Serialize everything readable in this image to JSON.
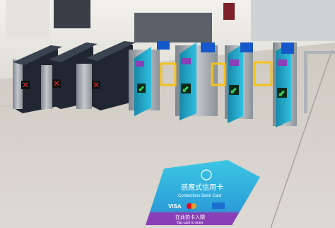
{
  "scene": {
    "description_kind": "photo",
    "colors": {
      "wall": "#e9e7e1",
      "floor": "#d6d2cb",
      "gate_dark": "#1e2530",
      "gate_steel": "#9aa0a6",
      "gate_cyan": "#27b6d9",
      "gate_cyan_dark": "#1888a8",
      "panel_yellow": "#f3c21b",
      "signal_red": "#e1262b",
      "signal_green": "#39d257",
      "screen_blue": "#1558c9",
      "decal_cyan": "#2fc0e0",
      "decal_purple": "#8a3fb6",
      "decal_blue": "#1a6fd1"
    },
    "gate_signals": [
      "stop-icon",
      "stop-icon",
      "arrow-icon",
      "arrow-icon",
      "arrow-icon",
      "arrow-icon"
    ],
    "floor_sign": {
      "line1": "感應式信用卡",
      "line2": "Contactless Bank Card",
      "brands": [
        "VISA"
      ],
      "line3": "在此拍卡入閘",
      "line4": "Tap card to enter"
    }
  }
}
